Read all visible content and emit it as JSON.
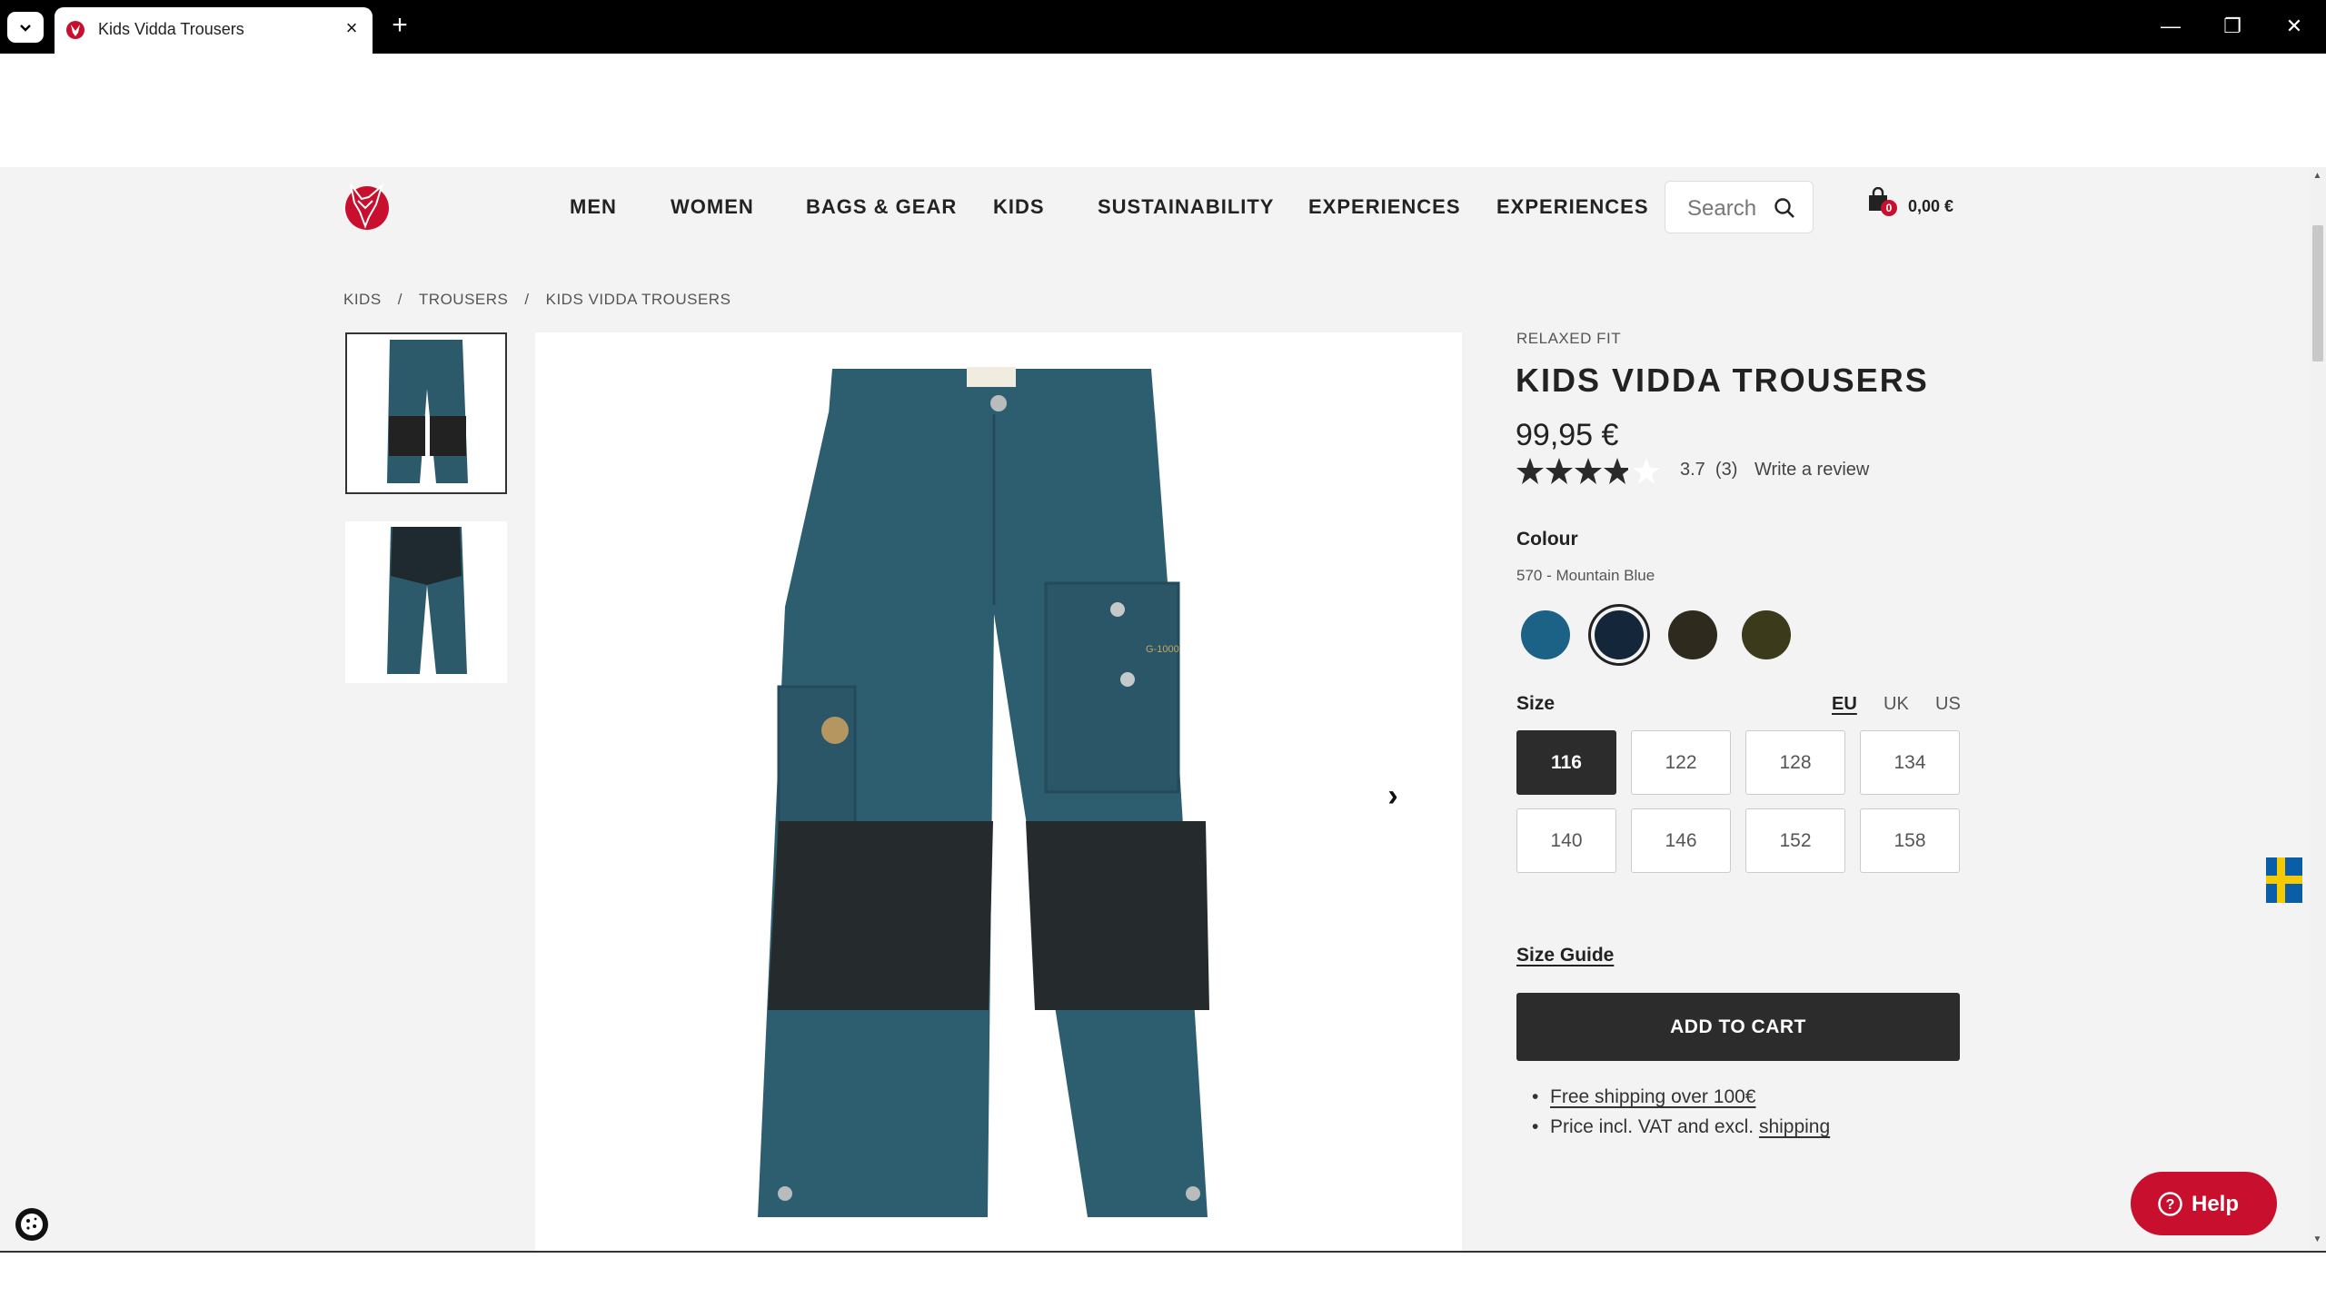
{
  "browser": {
    "tab_title": "Kids Vidda Trousers",
    "tab_close": "×",
    "new_tab": "+",
    "minimize": "—",
    "restore": "❐",
    "close": "✕"
  },
  "nav": {
    "items": [
      "MEN",
      "WOMEN",
      "BAGS & GEAR",
      "KIDS",
      "SUSTAINABILITY",
      "EXPERIENCES",
      "EXPERIENCES"
    ],
    "search_placeholder": "Search",
    "cart_count": "0",
    "cart_total": "0,00 €"
  },
  "breadcrumb": [
    "KIDS",
    "TROUSERS",
    "KIDS VIDDA TROUSERS"
  ],
  "breadcrumb_sep": "/",
  "product": {
    "fit": "RELAXED FIT",
    "title": "KIDS VIDDA TROUSERS",
    "price": "99,95 €",
    "rating_value": 3.7,
    "rating_text": "3.7  (3)",
    "write_review": "Write a review",
    "patch_text": "G-1000"
  },
  "colour": {
    "label": "Colour",
    "selected_name": "570 - Mountain Blue",
    "swatches": [
      {
        "name": "blue",
        "hex": "#1b6286"
      },
      {
        "name": "navy",
        "hex": "#14263a"
      },
      {
        "name": "dark-brown",
        "hex": "#2e2a1d"
      },
      {
        "name": "dark-olive",
        "hex": "#3b3a1a"
      }
    ],
    "selected_index": 1
  },
  "size": {
    "label": "Size",
    "systems": [
      "EU",
      "UK",
      "US"
    ],
    "active_system": "EU",
    "options": [
      "116",
      "122",
      "128",
      "134",
      "140",
      "146",
      "152",
      "158"
    ],
    "selected": "116",
    "guide": "Size Guide"
  },
  "cart": {
    "add_label": "ADD TO CART"
  },
  "info": {
    "shipping_link": "Free shipping over 100€",
    "vat_prefix": "Price incl. VAT and excl. ",
    "vat_link": "shipping"
  },
  "help": {
    "label": "Help"
  },
  "colors": {
    "brand_red": "#c8102e",
    "button_dark": "#2c2c2c",
    "page_bg": "#f3f3f3"
  }
}
